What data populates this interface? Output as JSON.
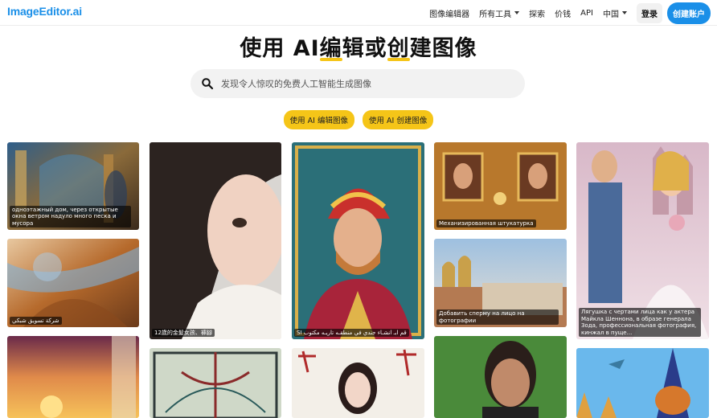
{
  "brand": {
    "logo": "ImageEditor.ai"
  },
  "nav": {
    "image_editor": "图像编辑器",
    "all_tools": "所有工具",
    "explore": "探索",
    "pricing": "价钱",
    "api": "API",
    "region": "中国",
    "login": "登录",
    "signup": "创建账户"
  },
  "hero": {
    "title_part1": "使用 AI",
    "title_hl1": "编",
    "title_part2": "辑或",
    "title_hl2": "创",
    "title_part3": "建图像"
  },
  "search": {
    "placeholder": "发现令人惊叹的免费人工智能生成图像"
  },
  "cta": {
    "edit": "使用 AI 编辑图像",
    "create": "使用 AI 创建图像"
  },
  "gallery": {
    "captions": {
      "c1": "одноэтажный дом, через открытые окна ветром надуло много песка и мусора",
      "c2": "شركة تسويق شبكي",
      "c3": "12歲的金髮女孩、褲腳",
      "c4": "SI قم ابـ انشـاء جندي في منطقـه تاريـه مكتوب",
      "c5": "Механизированная штукатурка",
      "c6": "Добавить сперму на лицо на фотографии",
      "c7": "Лягушка с чертами лица как у актера Майкла Шеннона, в образе генерала Зода, профессиональная фотография, кинжал в пуще..."
    }
  },
  "colors": {
    "accent_blue": "#1a8fe8",
    "accent_yellow": "#f5c518",
    "search_bg": "#f2f2f2"
  }
}
